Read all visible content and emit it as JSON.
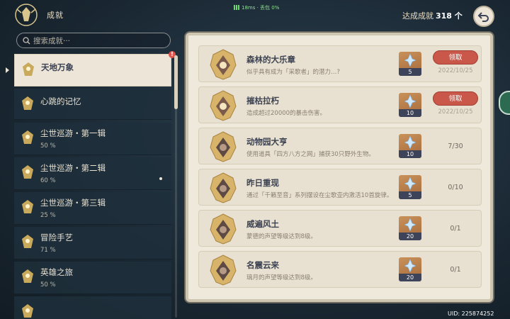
{
  "header": {
    "title": "成就",
    "network": "18ms · 丢包 0%",
    "count_label": "达成成就",
    "count_value": "318 个"
  },
  "search": {
    "placeholder": "搜索成就···"
  },
  "categories": [
    {
      "name": "天地万象",
      "pct": "",
      "selected": true,
      "has_badge": true
    },
    {
      "name": "心跳的记忆",
      "pct": ""
    },
    {
      "name": "尘世巡游・第一辑",
      "pct": "50 %"
    },
    {
      "name": "尘世巡游・第二辑",
      "pct": "60 %"
    },
    {
      "name": "尘世巡游・第三辑",
      "pct": "25 %"
    },
    {
      "name": "冒险手艺",
      "pct": "71 %"
    },
    {
      "name": "英雄之旅",
      "pct": "50 %"
    }
  ],
  "badge_text": "!",
  "achievements": [
    {
      "title": "森林的大乐章",
      "desc": "似乎具有成为「采歌者」的潜力…?",
      "reward": "5",
      "status": "claim",
      "claim_label": "领取",
      "date": "2022/10/25"
    },
    {
      "title": "摧枯拉朽",
      "desc": "造成超过20000的暴击伤害。",
      "reward": "10",
      "status": "claim",
      "claim_label": "领取",
      "date": "2022/10/25"
    },
    {
      "title": "动物园大亨",
      "desc": "使用道具「四方八方之网」捕获30只野外生物。",
      "reward": "10",
      "status": "progress",
      "progress": "7/30"
    },
    {
      "title": "昨日重现",
      "desc": "通过「千籁至音」系列摆设在尘歌壶内激活10首旋律。",
      "reward": "5",
      "status": "progress",
      "progress": "0/10"
    },
    {
      "title": "威遍风土",
      "desc": "蒙德的声望等级达到8级。",
      "reward": "20",
      "status": "progress",
      "progress": "0/1"
    },
    {
      "title": "名震云来",
      "desc": "璃月的声望等级达到8级。",
      "reward": "20",
      "status": "progress",
      "progress": "0/1"
    }
  ],
  "uid": "UID: 225874252",
  "colors": {
    "accent": "#c9584a",
    "panel": "#efe9dc",
    "selected": "#ece5d8"
  }
}
